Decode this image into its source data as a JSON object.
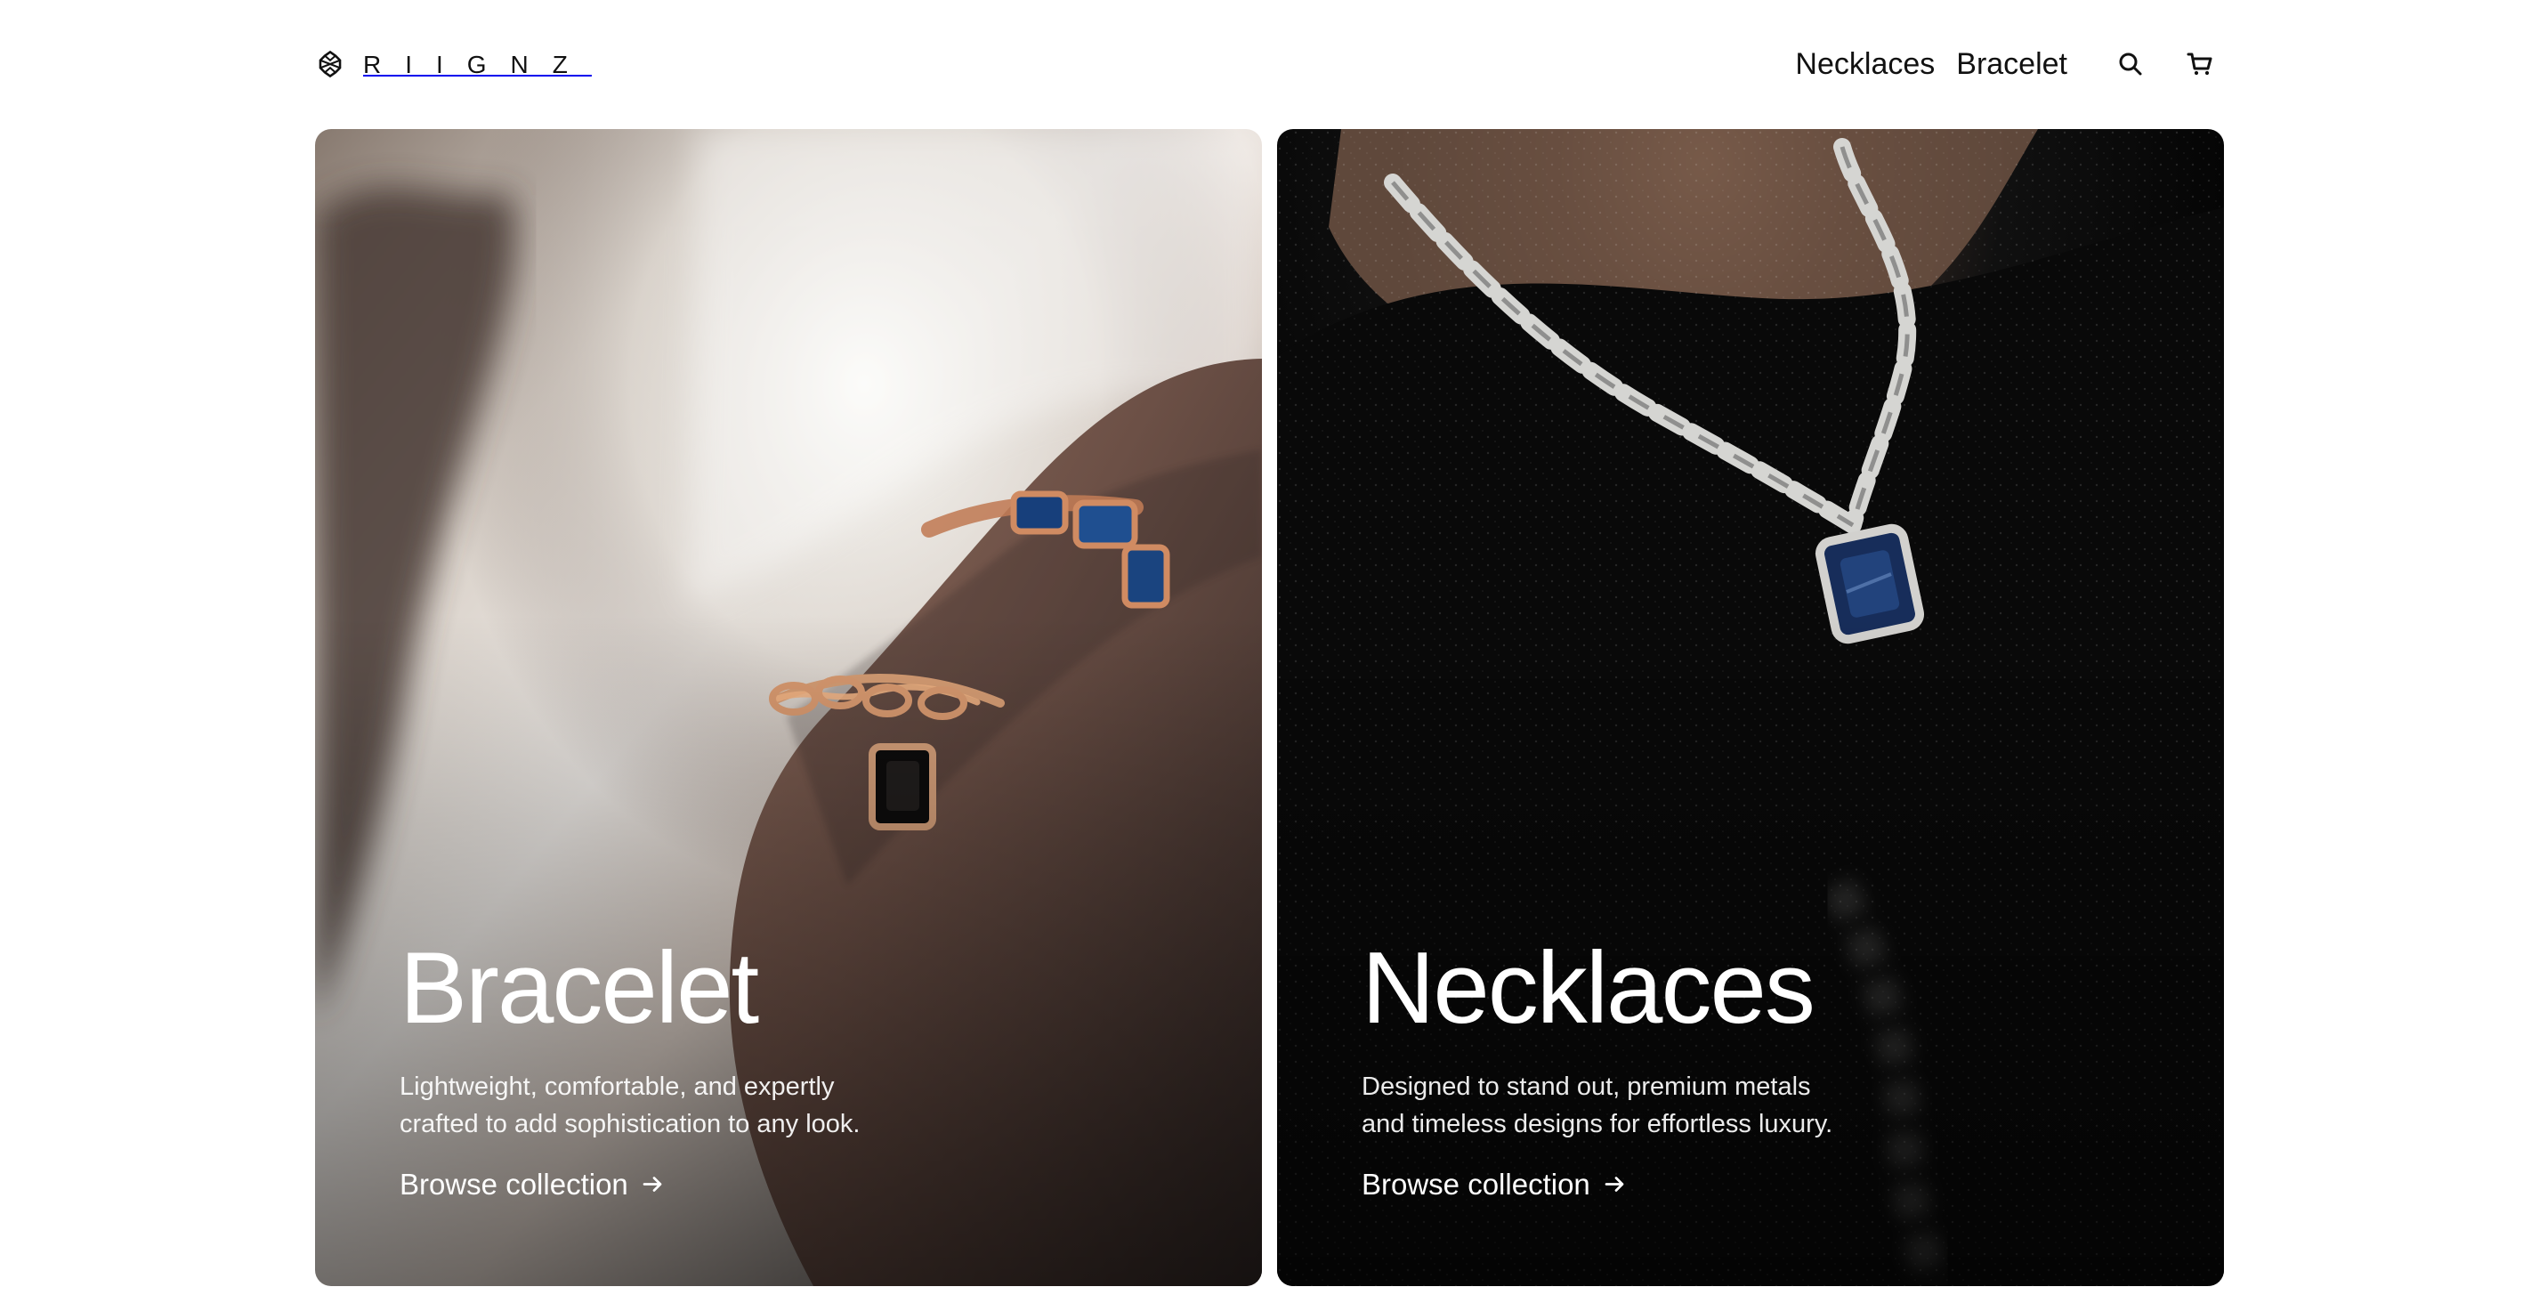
{
  "header": {
    "brand_text": "RIIGNZ",
    "logo_icon": "jewel-ring-logo-icon",
    "nav": [
      {
        "label": "Necklaces"
      },
      {
        "label": "Bracelet"
      }
    ],
    "actions": {
      "search_icon": "search-icon",
      "cart_icon": "cart-icon"
    }
  },
  "cards": [
    {
      "title": "Bracelet",
      "description": "Lightweight, comfortable, and expertly crafted to add sophistication to any look.",
      "cta_label": "Browse collection",
      "cta_icon": "arrow-right-icon",
      "image": "bracelet-photo-image"
    },
    {
      "title": "Necklaces",
      "description": "Designed to stand out, premium metals and timeless designs for effortless luxury.",
      "cta_label": "Browse collection",
      "cta_icon": "arrow-right-icon",
      "image": "necklace-photo-image"
    }
  ],
  "colors": {
    "text": "#111111",
    "background": "#ffffff",
    "overlay_text": "#ffffff"
  }
}
